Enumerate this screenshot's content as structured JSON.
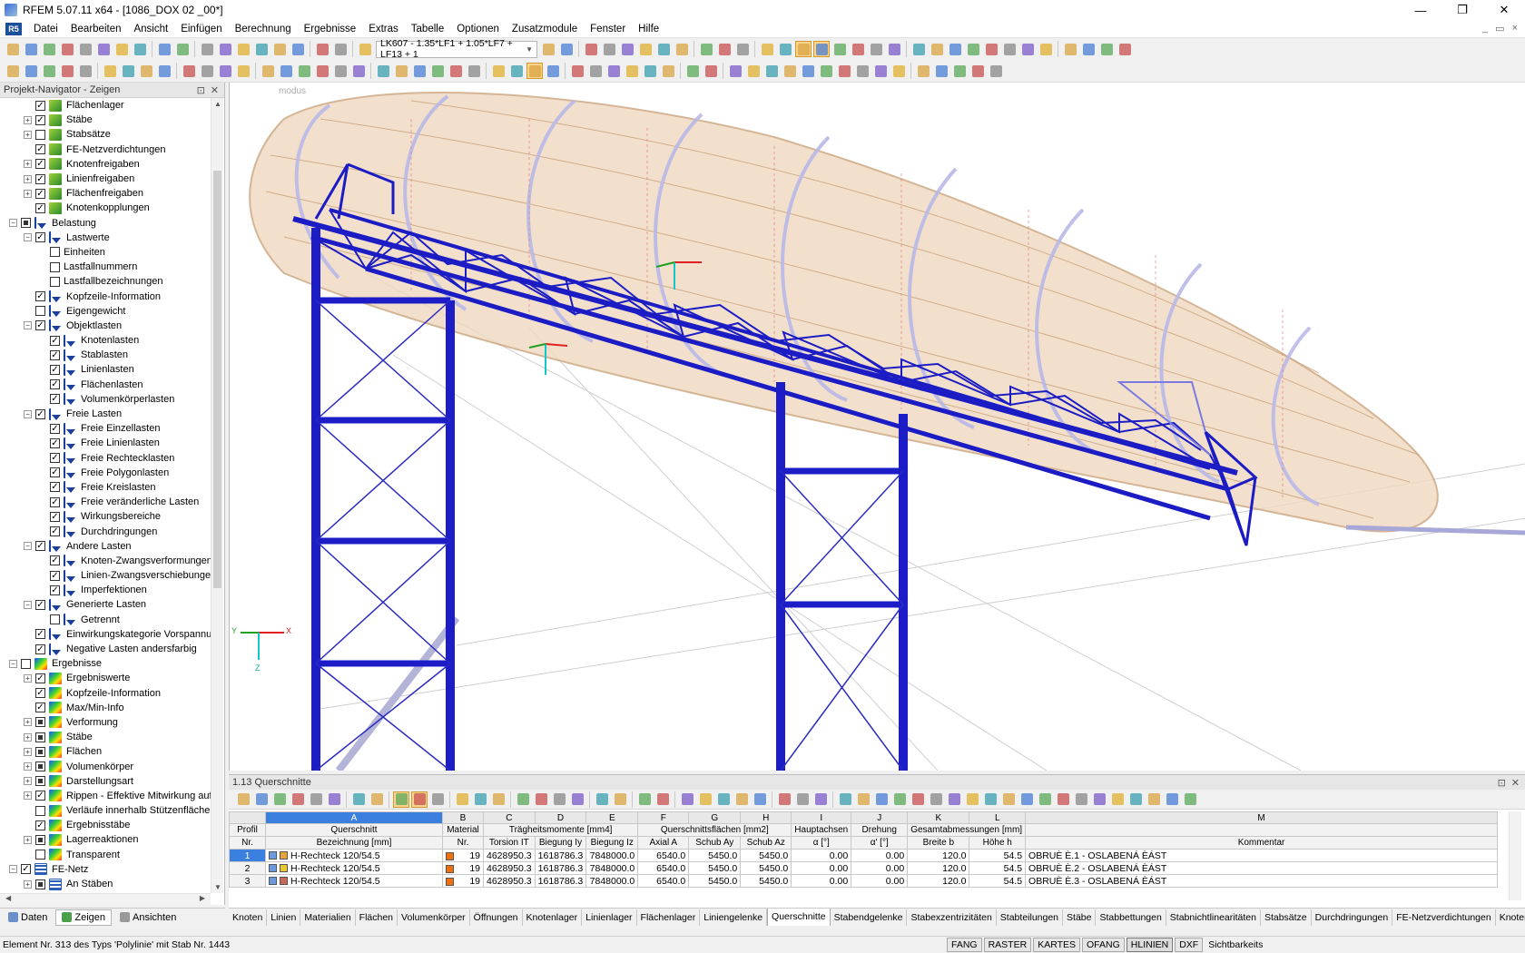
{
  "window": {
    "title": "RFEM 5.07.11 x64 - [1086_DOX 02 _00*]",
    "min": "—",
    "restore": "❐",
    "close": "✕"
  },
  "menu": [
    "Datei",
    "Bearbeiten",
    "Ansicht",
    "Einfügen",
    "Berechnung",
    "Ergebnisse",
    "Extras",
    "Tabelle",
    "Optionen",
    "Zusatzmodule",
    "Fenster",
    "Hilfe"
  ],
  "toolbar": {
    "loadcase": "LK607 - 1.35*LF1 + 1.05*LF7 + LF13 + 1"
  },
  "navigator": {
    "title": "Projekt-Navigator - Zeigen",
    "items": [
      {
        "d": 2,
        "e": "",
        "c": "x",
        "i": "sup",
        "t": "Flächenlager"
      },
      {
        "d": 2,
        "e": "+",
        "c": "x",
        "i": "sup",
        "t": "Stäbe"
      },
      {
        "d": 2,
        "e": "+",
        "c": "",
        "i": "sup",
        "t": "Stabsätze"
      },
      {
        "d": 2,
        "e": "",
        "c": "x",
        "i": "sup",
        "t": "FE-Netzverdichtungen"
      },
      {
        "d": 2,
        "e": "+",
        "c": "x",
        "i": "sup",
        "t": "Knotenfreigaben"
      },
      {
        "d": 2,
        "e": "+",
        "c": "x",
        "i": "sup",
        "t": "Linienfreigaben"
      },
      {
        "d": 2,
        "e": "+",
        "c": "x",
        "i": "sup",
        "t": "Flächenfreigaben"
      },
      {
        "d": 2,
        "e": "",
        "c": "x",
        "i": "sup",
        "t": "Knotenkopplungen"
      },
      {
        "d": 1,
        "e": "−",
        "c": "p",
        "i": "load",
        "t": "Belastung"
      },
      {
        "d": 2,
        "e": "−",
        "c": "x",
        "i": "load",
        "t": "Lastwerte"
      },
      {
        "d": 3,
        "e": "",
        "c": "",
        "i": "",
        "t": "Einheiten"
      },
      {
        "d": 3,
        "e": "",
        "c": "",
        "i": "",
        "t": "Lastfallnummern"
      },
      {
        "d": 3,
        "e": "",
        "c": "",
        "i": "",
        "t": "Lastfallbezeichnungen"
      },
      {
        "d": 2,
        "e": "",
        "c": "x",
        "i": "load",
        "t": "Kopfzeile-Information"
      },
      {
        "d": 2,
        "e": "",
        "c": "",
        "i": "load",
        "t": "Eigengewicht"
      },
      {
        "d": 2,
        "e": "−",
        "c": "x",
        "i": "load",
        "t": "Objektlasten"
      },
      {
        "d": 3,
        "e": "",
        "c": "x",
        "i": "load",
        "t": "Knotenlasten"
      },
      {
        "d": 3,
        "e": "",
        "c": "x",
        "i": "load",
        "t": "Stablasten"
      },
      {
        "d": 3,
        "e": "",
        "c": "x",
        "i": "load",
        "t": "Linienlasten"
      },
      {
        "d": 3,
        "e": "",
        "c": "x",
        "i": "load",
        "t": "Flächenlasten"
      },
      {
        "d": 3,
        "e": "",
        "c": "x",
        "i": "load",
        "t": "Volumenkörperlasten"
      },
      {
        "d": 2,
        "e": "−",
        "c": "x",
        "i": "load",
        "t": "Freie Lasten"
      },
      {
        "d": 3,
        "e": "",
        "c": "x",
        "i": "load",
        "t": "Freie Einzellasten"
      },
      {
        "d": 3,
        "e": "",
        "c": "x",
        "i": "load",
        "t": "Freie Linienlasten"
      },
      {
        "d": 3,
        "e": "",
        "c": "x",
        "i": "load",
        "t": "Freie Rechtecklasten"
      },
      {
        "d": 3,
        "e": "",
        "c": "x",
        "i": "load",
        "t": "Freie Polygonlasten"
      },
      {
        "d": 3,
        "e": "",
        "c": "x",
        "i": "load",
        "t": "Freie Kreislasten"
      },
      {
        "d": 3,
        "e": "",
        "c": "x",
        "i": "load",
        "t": "Freie veränderliche Lasten"
      },
      {
        "d": 3,
        "e": "",
        "c": "x",
        "i": "load",
        "t": "Wirkungsbereiche"
      },
      {
        "d": 3,
        "e": "",
        "c": "x",
        "i": "load",
        "t": "Durchdringungen"
      },
      {
        "d": 2,
        "e": "−",
        "c": "x",
        "i": "load",
        "t": "Andere Lasten"
      },
      {
        "d": 3,
        "e": "",
        "c": "x",
        "i": "load",
        "t": "Knoten-Zwangsverformungen"
      },
      {
        "d": 3,
        "e": "",
        "c": "x",
        "i": "load",
        "t": "Linien-Zwangsverschiebungen"
      },
      {
        "d": 3,
        "e": "",
        "c": "x",
        "i": "load",
        "t": "Imperfektionen"
      },
      {
        "d": 2,
        "e": "−",
        "c": "x",
        "i": "load",
        "t": "Generierte Lasten"
      },
      {
        "d": 3,
        "e": "",
        "c": "",
        "i": "load",
        "t": "Getrennt"
      },
      {
        "d": 2,
        "e": "",
        "c": "x",
        "i": "load",
        "t": "Einwirkungskategorie Vorspannung"
      },
      {
        "d": 2,
        "e": "",
        "c": "x",
        "i": "load",
        "t": "Negative Lasten andersfarbig"
      },
      {
        "d": 1,
        "e": "−",
        "c": "",
        "i": "res",
        "t": "Ergebnisse"
      },
      {
        "d": 2,
        "e": "+",
        "c": "x",
        "i": "res",
        "t": "Ergebniswerte"
      },
      {
        "d": 2,
        "e": "",
        "c": "x",
        "i": "res",
        "t": "Kopfzeile-Information"
      },
      {
        "d": 2,
        "e": "",
        "c": "x",
        "i": "res",
        "t": "Max/Min-Info"
      },
      {
        "d": 2,
        "e": "+",
        "c": "p",
        "i": "res",
        "t": "Verformung"
      },
      {
        "d": 2,
        "e": "+",
        "c": "p",
        "i": "res",
        "t": "Stäbe"
      },
      {
        "d": 2,
        "e": "+",
        "c": "p",
        "i": "res",
        "t": "Flächen"
      },
      {
        "d": 2,
        "e": "+",
        "c": "p",
        "i": "res",
        "t": "Volumenkörper"
      },
      {
        "d": 2,
        "e": "+",
        "c": "p",
        "i": "res",
        "t": "Darstellungsart"
      },
      {
        "d": 2,
        "e": "+",
        "c": "x",
        "i": "res",
        "t": "Rippen - Effektive Mitwirkung auf F"
      },
      {
        "d": 2,
        "e": "",
        "c": "",
        "i": "res",
        "t": "Verläufe innerhalb Stützenfläche"
      },
      {
        "d": 2,
        "e": "",
        "c": "x",
        "i": "res",
        "t": "Ergebnisstäbe"
      },
      {
        "d": 2,
        "e": "+",
        "c": "p",
        "i": "res",
        "t": "Lagerreaktionen"
      },
      {
        "d": 2,
        "e": "",
        "c": "",
        "i": "res",
        "t": "Transparent"
      },
      {
        "d": 1,
        "e": "−",
        "c": "x",
        "i": "grid",
        "t": "FE-Netz"
      },
      {
        "d": 2,
        "e": "+",
        "c": "p",
        "i": "grid",
        "t": "An Stäben"
      }
    ],
    "tabs": [
      "Daten",
      "Zeigen",
      "Ansichten"
    ]
  },
  "viewport": {
    "label": "modus",
    "axis_x": "X",
    "axis_y": "Y",
    "axis_z": "Z"
  },
  "table": {
    "title": "1.13 Querschnitte",
    "letters": [
      "",
      "A",
      "B",
      "C",
      "D",
      "E",
      "F",
      "G",
      "H",
      "I",
      "J",
      "K",
      "L",
      "M"
    ],
    "h1": [
      "Profil",
      "Querschnitt",
      "Material",
      "Trägheitsmomente [mm4]",
      "",
      "",
      "Querschnittsflächen [mm2]",
      "",
      "",
      "Hauptachsen",
      "Drehung",
      "Gesamtabmessungen [mm]",
      "",
      ""
    ],
    "h2": [
      "Nr.",
      "Bezeichnung [mm]",
      "Nr.",
      "Torsion IT",
      "Biegung Iy",
      "Biegung Iz",
      "Axial A",
      "Schub Ay",
      "Schub Az",
      "α [°]",
      "α' [°]",
      "Breite b",
      "Höhe h",
      "Kommentar"
    ],
    "rows": [
      {
        "nr": "1",
        "color": "#e8a33a",
        "name": "H-Rechteck 120/54.5",
        "mat": "19",
        "it": "4628950.3",
        "iy": "1618786.3",
        "iz": "7848000.0",
        "a": "6540.0",
        "ay": "5450.0",
        "az": "5450.0",
        "al": "0.00",
        "al2": "0.00",
        "b": "120.0",
        "h": "54.5",
        "kom": "OBRUÈ È.1 - OSLABENÁ ÈÁST"
      },
      {
        "nr": "2",
        "color": "#e8c830",
        "name": "H-Rechteck 120/54.5",
        "mat": "19",
        "it": "4628950.3",
        "iy": "1618786.3",
        "iz": "7848000.0",
        "a": "6540.0",
        "ay": "5450.0",
        "az": "5450.0",
        "al": "0.00",
        "al2": "0.00",
        "b": "120.0",
        "h": "54.5",
        "kom": "OBRUÈ È.2 - OSLABENÁ ÈÁST"
      },
      {
        "nr": "3",
        "color": "#c86a5a",
        "name": "H-Rechteck 120/54.5",
        "mat": "19",
        "it": "4628950.3",
        "iy": "1618786.3",
        "iz": "7848000.0",
        "a": "6540.0",
        "ay": "5450.0",
        "az": "5450.0",
        "al": "0.00",
        "al2": "0.00",
        "b": "120.0",
        "h": "54.5",
        "kom": "OBRUÈ È.3 - OSLABENÁ ÈÁST"
      }
    ]
  },
  "sheet_tabs": [
    "Knoten",
    "Linien",
    "Materialien",
    "Flächen",
    "Volumenkörper",
    "Öffnungen",
    "Knotenlager",
    "Linienlager",
    "Flächenlager",
    "Liniengelenke",
    "Querschnitte",
    "Stabendgelenke",
    "Stabexzentrizitäten",
    "Stabteilungen",
    "Stäbe",
    "Stabbettungen",
    "Stabnichtlinearitäten",
    "Stabsätze",
    "Durchdringungen",
    "FE-Netzverdichtungen",
    "Knotenfreigaben"
  ],
  "active_sheet": "Querschnitte",
  "status": {
    "text": "Element Nr. 313 des Typs 'Polylinie' mit Stab Nr. 1443",
    "buttons": [
      "FANG",
      "RASTER",
      "KARTES",
      "OFANG",
      "HLINIEN",
      "DXF"
    ],
    "last": "Sichtbarkeits"
  }
}
